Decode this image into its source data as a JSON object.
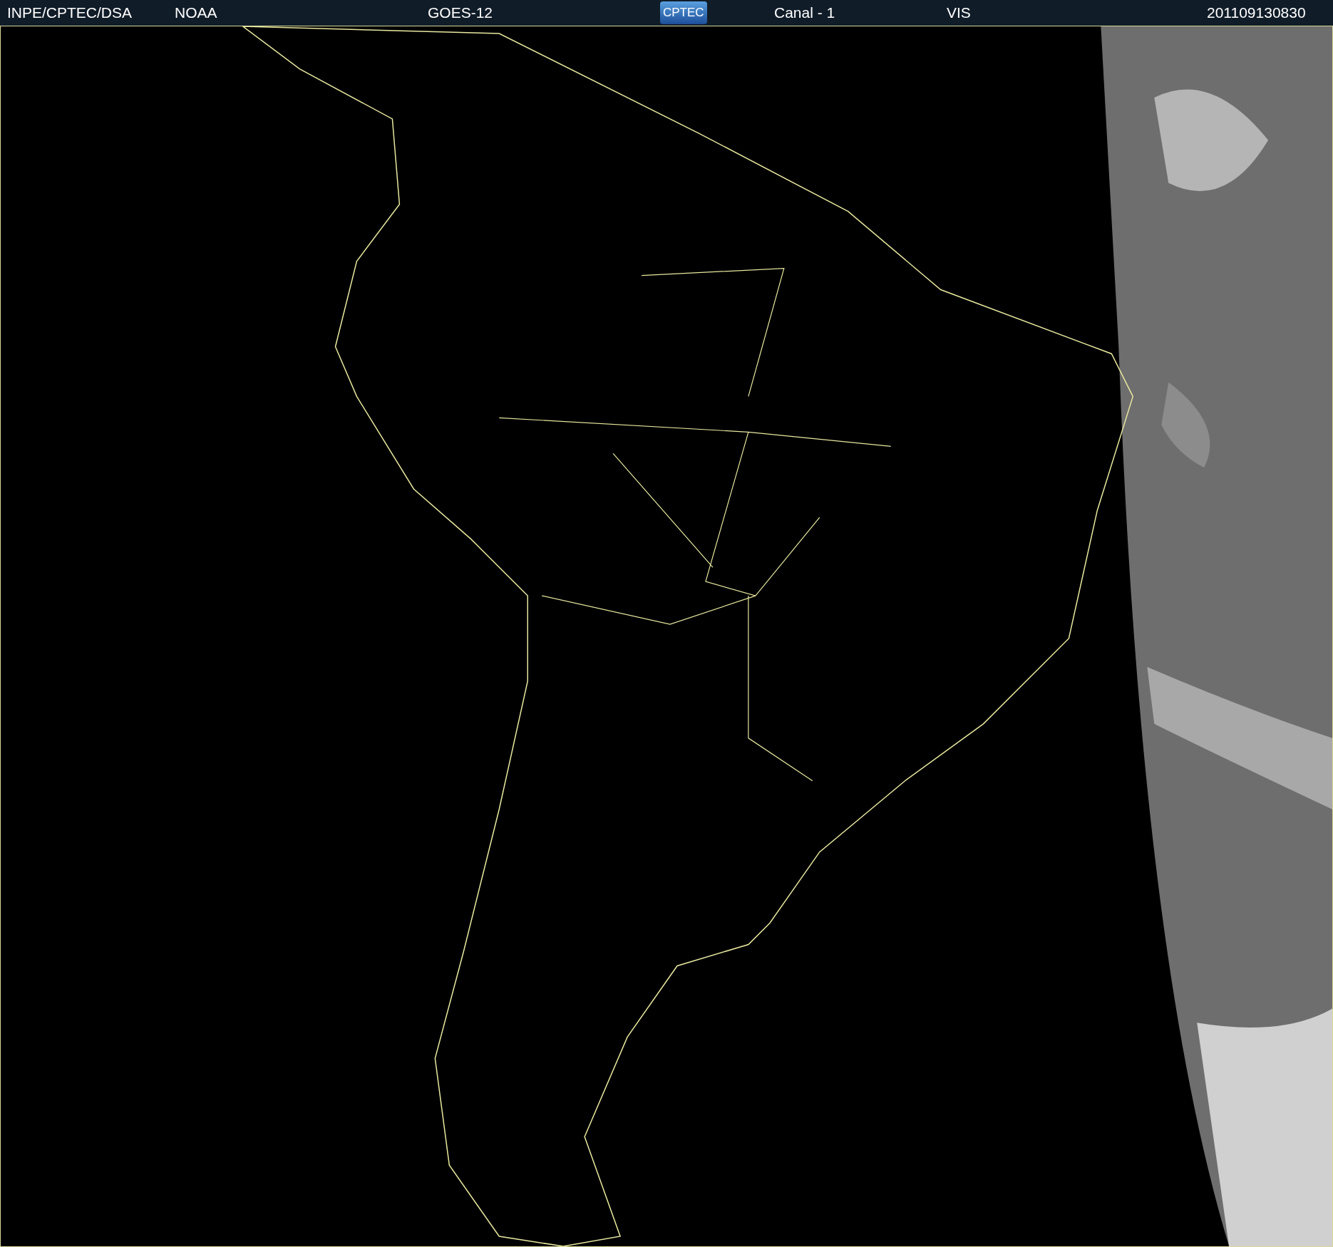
{
  "header": {
    "agency": "INPE/CPTEC/DSA",
    "source": "NOAA",
    "satellite": "GOES-12",
    "logo": "CPTEC",
    "channel": "Canal - 1",
    "band": "VIS",
    "timestamp": "201109130830"
  }
}
